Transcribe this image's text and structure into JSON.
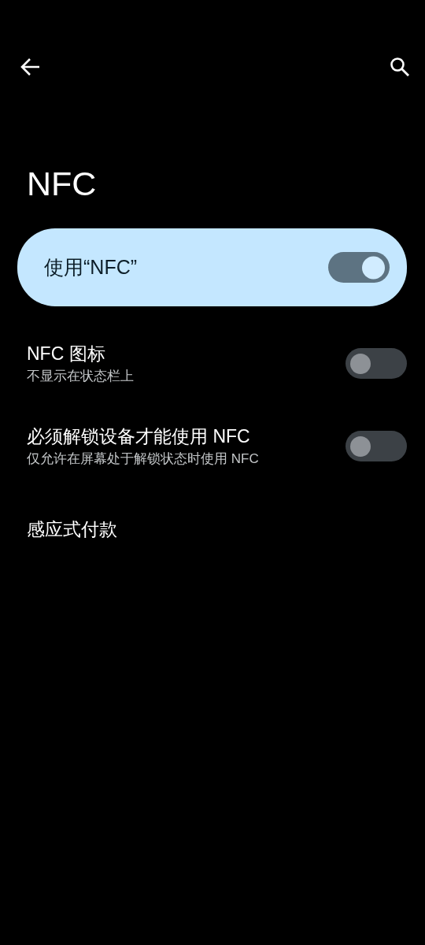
{
  "title": "NFC",
  "main_switch": {
    "label": "使用“NFC”",
    "on": true
  },
  "settings": [
    {
      "kind": "switch",
      "title": "NFC 图标",
      "subtitle": "不显示在状态栏上",
      "on": false
    },
    {
      "kind": "switch",
      "title": "必须解锁设备才能使用 NFC",
      "subtitle": "仅允许在屏幕处于解锁状态时使用 NFC",
      "on": false
    },
    {
      "kind": "link",
      "title": "感应式付款"
    }
  ]
}
